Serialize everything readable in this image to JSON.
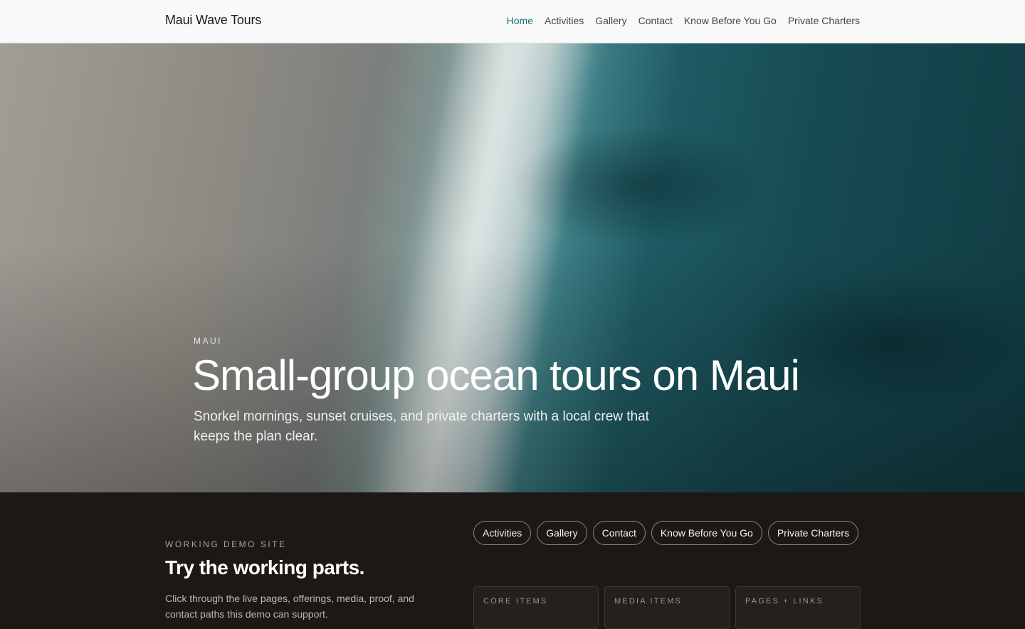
{
  "header": {
    "brand": "Maui Wave Tours",
    "nav": [
      {
        "label": "Home",
        "active": true
      },
      {
        "label": "Activities"
      },
      {
        "label": "Gallery"
      },
      {
        "label": "Contact"
      },
      {
        "label": "Know Before You Go"
      },
      {
        "label": "Private Charters"
      }
    ]
  },
  "hero": {
    "eyebrow": "MAUI",
    "title": "Small-group ocean tours on Maui",
    "subtitle": "Snorkel mornings, sunset cruises, and private charters with a local crew that keeps the plan clear."
  },
  "demo": {
    "eyebrow": "WORKING DEMO SITE",
    "title": "Try the working parts.",
    "copy": "Click through the live pages, offerings, media, proof, and contact paths this demo can support.",
    "pills": [
      "Activities",
      "Gallery",
      "Contact",
      "Know Before You Go",
      "Private Charters"
    ],
    "cards": [
      "CORE ITEMS",
      "MEDIA ITEMS",
      "PAGES + LINKS"
    ]
  },
  "colors": {
    "accent": "#1b6b72",
    "dark_section": "#1c1815",
    "header_bg": "#f9f9f9"
  }
}
